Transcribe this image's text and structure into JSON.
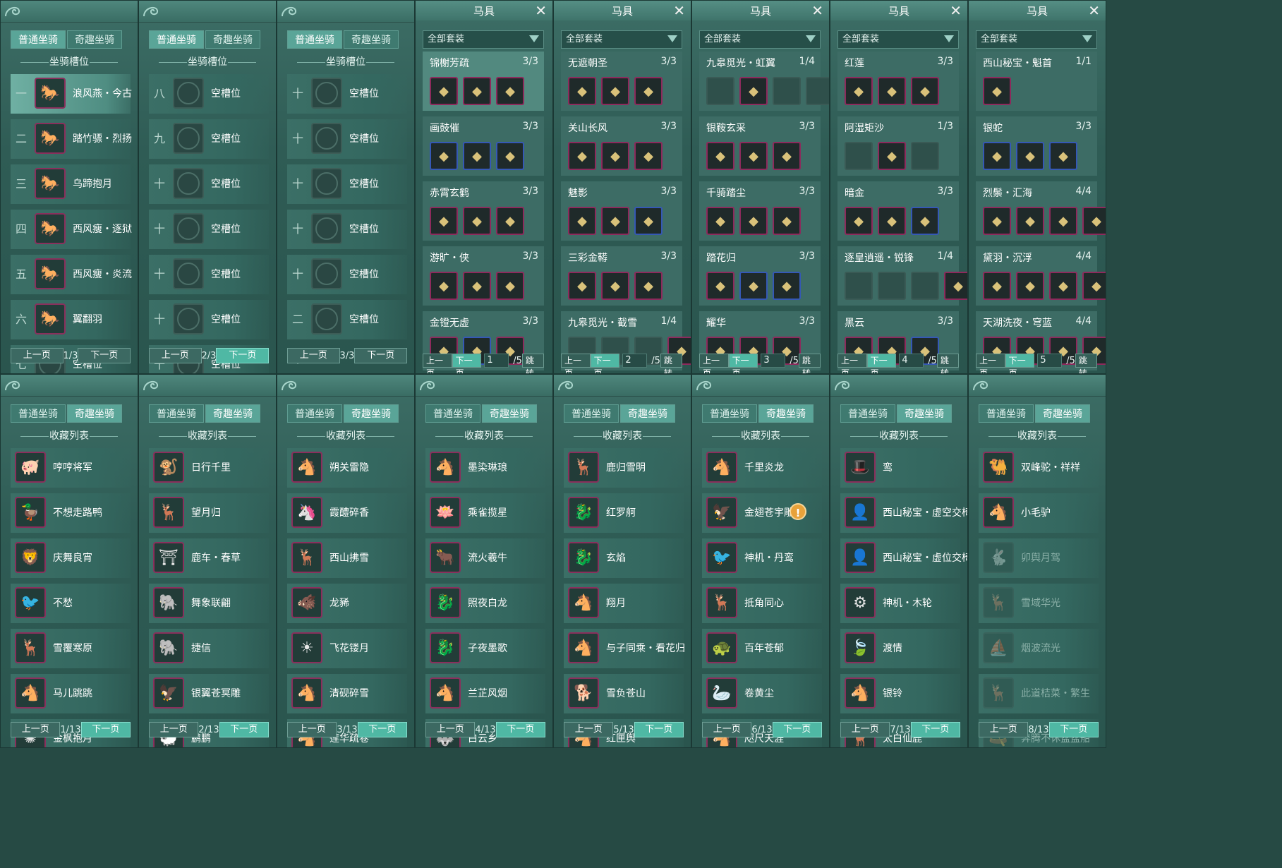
{
  "slot_panels": [
    {
      "tabs": [
        "普通坐骑",
        "奇趣坐骑"
      ],
      "active_tab": 0,
      "section": "坐骑槽位",
      "rows": [
        {
          "num": "一",
          "name": "浪风燕・今古",
          "icon": "white-horse-icon",
          "filled": true,
          "selected": true
        },
        {
          "num": "二",
          "name": "踏竹骠・烈扬",
          "icon": "red-horse-icon",
          "filled": true
        },
        {
          "num": "三",
          "name": "乌蹄抱月",
          "icon": "white-horse-icon",
          "filled": true
        },
        {
          "num": "四",
          "name": "西风瘦・逐狱",
          "icon": "black-horse-icon",
          "filled": true
        },
        {
          "num": "五",
          "name": "西风瘦・炎流",
          "icon": "black-horse-icon",
          "filled": true
        },
        {
          "num": "六",
          "name": "翼翻羽",
          "icon": "black-horse-icon",
          "filled": true
        },
        {
          "num": "七",
          "name": "空槽位",
          "filled": false
        }
      ],
      "prev": "上一页",
      "page": "1/3",
      "next": "下一页",
      "next_hi": false,
      "prev_hi": false
    },
    {
      "tabs": [
        "普通坐骑",
        "奇趣坐骑"
      ],
      "active_tab": 0,
      "section": "坐骑槽位",
      "rows": [
        {
          "num": "八",
          "name": "空槽位",
          "filled": false
        },
        {
          "num": "九",
          "name": "空槽位",
          "filled": false
        },
        {
          "num": "十",
          "name": "空槽位",
          "filled": false
        },
        {
          "num": "十一",
          "name": "空槽位",
          "filled": false
        },
        {
          "num": "十二",
          "name": "空槽位",
          "filled": false
        },
        {
          "num": "十三",
          "name": "空槽位",
          "filled": false
        },
        {
          "num": "十四",
          "name": "空槽位",
          "filled": false
        }
      ],
      "prev": "上一页",
      "page": "2/3",
      "next": "下一页",
      "next_hi": true
    },
    {
      "tabs": [
        "普通坐骑",
        "奇趣坐骑"
      ],
      "active_tab": 0,
      "section": "坐骑槽位",
      "rows": [
        {
          "num": "十五",
          "name": "空槽位",
          "filled": false
        },
        {
          "num": "十六",
          "name": "空槽位",
          "filled": false
        },
        {
          "num": "十七",
          "name": "空槽位",
          "filled": false
        },
        {
          "num": "十八",
          "name": "空槽位",
          "filled": false
        },
        {
          "num": "十九",
          "name": "空槽位",
          "filled": false
        },
        {
          "num": "二十",
          "name": "空槽位",
          "filled": false
        }
      ],
      "prev": "上一页",
      "page": "3/3",
      "next": "下一页",
      "next_hi": false
    }
  ],
  "equip_panels": [
    {
      "title": "马具",
      "filter": "全部套装",
      "page": "1",
      "total": "/5",
      "prev": "上一页",
      "next": "下一页",
      "jump": "跳转",
      "sets": [
        {
          "name": "锦榭芳疏",
          "count": "3/3",
          "selected": true,
          "items": [
            "p",
            "p",
            "p"
          ]
        },
        {
          "name": "画鼓催",
          "count": "3/3",
          "items": [
            "b",
            "b",
            "b"
          ]
        },
        {
          "name": "赤霄玄鹤",
          "count": "3/3",
          "items": [
            "p",
            "p",
            "p"
          ]
        },
        {
          "name": "游旷・侠",
          "count": "3/3",
          "items": [
            "p",
            "p",
            "p"
          ]
        },
        {
          "name": "金镫无虚",
          "count": "3/3",
          "items": [
            "p",
            "b",
            "p"
          ]
        }
      ]
    },
    {
      "title": "马具",
      "filter": "全部套装",
      "page": "2",
      "total": "/5",
      "prev": "上一页",
      "next": "下一页",
      "jump": "跳转",
      "sets": [
        {
          "name": "无遮朝圣",
          "count": "3/3",
          "items": [
            "p",
            "p",
            "p"
          ]
        },
        {
          "name": "关山长风",
          "count": "3/3",
          "items": [
            "p",
            "p",
            "p"
          ]
        },
        {
          "name": "魅影",
          "count": "3/3",
          "items": [
            "p",
            "p",
            "b"
          ]
        },
        {
          "name": "三彩金鞯",
          "count": "3/3",
          "items": [
            "p",
            "p",
            "p"
          ]
        },
        {
          "name": "九皋觅光・截雪",
          "count": "1/4",
          "items": [
            "n",
            "n",
            "n",
            "p"
          ]
        }
      ]
    },
    {
      "title": "马具",
      "filter": "全部套装",
      "page": "3",
      "total": "/5",
      "prev": "上一页",
      "next": "下一页",
      "jump": "跳转",
      "sets": [
        {
          "name": "九皋觅光・虹翼",
          "count": "1/4",
          "items": [
            "n",
            "p",
            "n",
            "n"
          ]
        },
        {
          "name": "银鞍玄采",
          "count": "3/3",
          "items": [
            "p",
            "p",
            "p"
          ]
        },
        {
          "name": "千骑踏尘",
          "count": "3/3",
          "items": [
            "p",
            "p",
            "p"
          ]
        },
        {
          "name": "踏花归",
          "count": "3/3",
          "items": [
            "p",
            "b",
            "b"
          ]
        },
        {
          "name": "耀华",
          "count": "3/3",
          "items": [
            "p",
            "p",
            "p"
          ]
        }
      ]
    },
    {
      "title": "马具",
      "filter": "全部套装",
      "page": "4",
      "total": "/5",
      "prev": "上一页",
      "next": "下一页",
      "jump": "跳转",
      "sets": [
        {
          "name": "红莲",
          "count": "3/3",
          "items": [
            "p",
            "p",
            "p"
          ]
        },
        {
          "name": "阿湿矩沙",
          "count": "1/3",
          "items": [
            "n",
            "p",
            "n"
          ]
        },
        {
          "name": "暗金",
          "count": "3/3",
          "items": [
            "p",
            "p",
            "b"
          ]
        },
        {
          "name": "逐皇逍遥・锐锋",
          "count": "1/4",
          "items": [
            "n",
            "n",
            "n",
            "p"
          ]
        },
        {
          "name": "黑云",
          "count": "3/3",
          "items": [
            "p",
            "p",
            "b"
          ]
        }
      ]
    },
    {
      "title": "马具",
      "filter": "全部套装",
      "page": "5",
      "total": "/5",
      "prev": "上一页",
      "next": "下一页",
      "jump": "跳转",
      "sets": [
        {
          "name": "西山秘宝・魁首",
          "count": "1/1",
          "items": [
            "p"
          ]
        },
        {
          "name": "银蛇",
          "count": "3/3",
          "items": [
            "b",
            "b",
            "b"
          ]
        },
        {
          "name": "烈鬃・汇海",
          "count": "4/4",
          "items": [
            "p",
            "p",
            "p",
            "p"
          ]
        },
        {
          "name": "黛羽・沉浮",
          "count": "4/4",
          "items": [
            "p",
            "p",
            "p",
            "p"
          ]
        },
        {
          "name": "天湖洗夜・穹蓝",
          "count": "4/4",
          "items": [
            "p",
            "p",
            "p",
            "p"
          ]
        }
      ]
    }
  ],
  "collection_panels": [
    {
      "tabs": [
        "普通坐骑",
        "奇趣坐骑"
      ],
      "active_tab": 1,
      "section": "收藏列表",
      "page": "1/13",
      "prev": "上一页",
      "next": "下一页",
      "prev_hi": true,
      "rows": [
        {
          "name": "哼哼将军",
          "g": "🐖"
        },
        {
          "name": "不想走路鸭",
          "g": "🦆"
        },
        {
          "name": "庆舞良宵",
          "g": "🦁"
        },
        {
          "name": "不愁",
          "g": "🐦"
        },
        {
          "name": "雪覆寒原",
          "g": "🦌"
        },
        {
          "name": "马儿跳跳",
          "g": "🐴"
        },
        {
          "name": "金枫抱月",
          "g": "✺"
        }
      ]
    },
    {
      "tabs": [
        "普通坐骑",
        "奇趣坐骑"
      ],
      "active_tab": 1,
      "section": "收藏列表",
      "page": "2/13",
      "prev": "上一页",
      "next": "下一页",
      "rows": [
        {
          "name": "日行千里",
          "g": "🐒"
        },
        {
          "name": "望月归",
          "g": "🦌"
        },
        {
          "name": "鹿车・春草",
          "g": "⛩"
        },
        {
          "name": "舞象联翩",
          "g": "🐘"
        },
        {
          "name": "捷信",
          "g": "🐘"
        },
        {
          "name": "银翼苍冥雕",
          "g": "🦅"
        },
        {
          "name": "鹏鹏",
          "g": "🐑"
        }
      ]
    },
    {
      "tabs": [
        "普通坐骑",
        "奇趣坐骑"
      ],
      "active_tab": 1,
      "section": "收藏列表",
      "page": "3/13",
      "prev": "上一页",
      "next": "下一页",
      "rows": [
        {
          "name": "朔关雷隐",
          "g": "🐴"
        },
        {
          "name": "霞醴碎香",
          "g": "🦄"
        },
        {
          "name": "西山拂雪",
          "g": "🦌"
        },
        {
          "name": "龙豨",
          "g": "🐗"
        },
        {
          "name": "飞花镂月",
          "g": "☀"
        },
        {
          "name": "清砚碎雪",
          "g": "🐴"
        },
        {
          "name": "莲华疏卷",
          "g": "🐴"
        }
      ]
    },
    {
      "tabs": [
        "普通坐骑",
        "奇趣坐骑"
      ],
      "active_tab": 1,
      "section": "收藏列表",
      "page": "4/13",
      "prev": "上一页",
      "next": "下一页",
      "rows": [
        {
          "name": "墨染琳琅",
          "g": "🐴"
        },
        {
          "name": "乘雀揽星",
          "g": "🪷"
        },
        {
          "name": "流火羲牛",
          "g": "🐂"
        },
        {
          "name": "照夜白龙",
          "g": "🐉"
        },
        {
          "name": "子夜墨歌",
          "g": "🐉"
        },
        {
          "name": "兰芷风烟",
          "g": "🐴"
        },
        {
          "name": "白云乡",
          "g": "🐺"
        }
      ]
    },
    {
      "tabs": [
        "普通坐骑",
        "奇趣坐骑"
      ],
      "active_tab": 1,
      "section": "收藏列表",
      "page": "5/13",
      "prev": "上一页",
      "next": "下一页",
      "rows": [
        {
          "name": "鹿归雪明",
          "g": "🦌"
        },
        {
          "name": "红罗舸",
          "g": "🐉"
        },
        {
          "name": "玄焰",
          "g": "🐉"
        },
        {
          "name": "翔月",
          "g": "🐴"
        },
        {
          "name": "与子同乘・看花归",
          "g": "🐴"
        },
        {
          "name": "雪负苍山",
          "g": "🐕"
        },
        {
          "name": "红匣舆",
          "g": "🐴"
        }
      ]
    },
    {
      "tabs": [
        "普通坐骑",
        "奇趣坐骑"
      ],
      "active_tab": 1,
      "section": "收藏列表",
      "page": "6/13",
      "prev": "上一页",
      "next": "下一页",
      "alert_row": 1,
      "rows": [
        {
          "name": "千里炎龙",
          "g": "🐴"
        },
        {
          "name": "金翅苍宇雕",
          "g": "🦅"
        },
        {
          "name": "神机・丹鸾",
          "g": "🐦"
        },
        {
          "name": "抵角同心",
          "g": "🦌"
        },
        {
          "name": "百年苍郁",
          "g": "🐢"
        },
        {
          "name": "卷黄尘",
          "g": "🦢"
        },
        {
          "name": "咫尺天涯",
          "g": "🐴"
        }
      ]
    },
    {
      "tabs": [
        "普通坐骑",
        "奇趣坐骑"
      ],
      "active_tab": 1,
      "section": "收藏列表",
      "page": "7/13",
      "prev": "上一页",
      "next": "下一页",
      "rows": [
        {
          "name": "鸾",
          "g": "🎩"
        },
        {
          "name": "西山秘宝・虚空交椅",
          "g": "👤"
        },
        {
          "name": "西山秘宝・虚位交椅",
          "g": "👤"
        },
        {
          "name": "神机・木轮",
          "g": "⚙"
        },
        {
          "name": "渡情",
          "g": "🍃"
        },
        {
          "name": "银铃",
          "g": "🐴"
        },
        {
          "name": "太白仙鹿",
          "g": "🦌"
        }
      ]
    },
    {
      "tabs": [
        "普通坐骑",
        "奇趣坐骑"
      ],
      "active_tab": 1,
      "section": "收藏列表",
      "page": "8/13",
      "prev": "上一页",
      "next": "下一页",
      "rows": [
        {
          "name": "双峰驼・祥祥",
          "g": "🐫"
        },
        {
          "name": "小毛驴",
          "g": "🐴"
        },
        {
          "name": "卯舆月驾",
          "g": "🐇",
          "dim": true
        },
        {
          "name": "雪域华光",
          "g": "🦌",
          "dim": true
        },
        {
          "name": "烟波流光",
          "g": "⛵",
          "dim": true
        },
        {
          "name": "此道桔菜・繁生",
          "g": "🦌",
          "dim": true
        },
        {
          "name": "奔腾不休盆盆船",
          "g": "🛶",
          "dim": true
        }
      ]
    }
  ],
  "colors": {
    "accent": "#4fb8a4",
    "purple_border": "#8d2a5c",
    "blue_border": "#3558b5",
    "panel": "#2f5c55"
  }
}
